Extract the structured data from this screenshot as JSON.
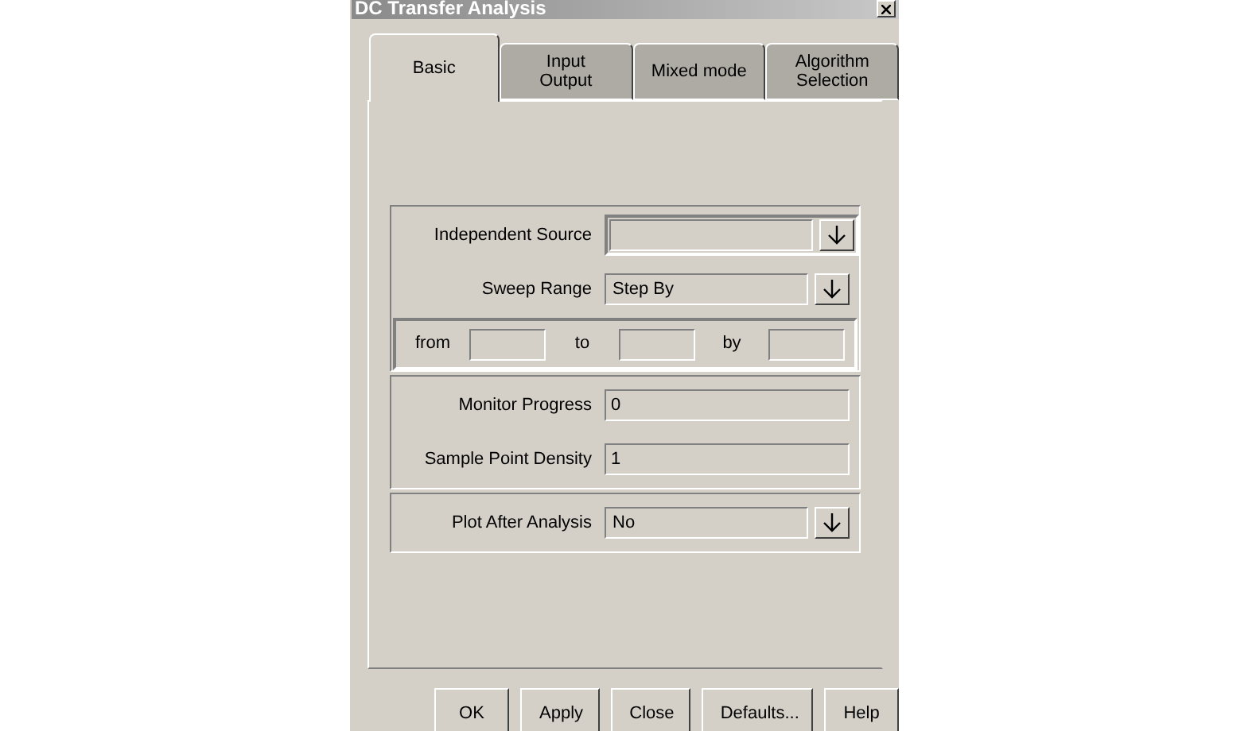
{
  "window": {
    "title": "DC Transfer Analysis"
  },
  "tabs": [
    {
      "label": "Basic",
      "selected": true
    },
    {
      "label": "Input\nOutput",
      "selected": false
    },
    {
      "label": "Mixed mode",
      "selected": false
    },
    {
      "label": "Algorithm\nSelection",
      "selected": false
    }
  ],
  "source_group": {
    "rows": [
      {
        "label": "Independent Source",
        "kind": "dropdown",
        "sunken": true
      },
      {
        "label": "Sweep Range",
        "kind": "dropdown",
        "value": "Step By"
      }
    ],
    "range": [
      {
        "label": "from"
      },
      {
        "label": "to"
      },
      {
        "label": "by"
      }
    ]
  },
  "progress_group": {
    "rows": [
      {
        "label": "Monitor Progress",
        "kind": "field",
        "value": "0"
      },
      {
        "label": "Sample Point Density",
        "kind": "field",
        "value": "1"
      }
    ]
  },
  "plot_group": {
    "rows": [
      {
        "label": "Plot After Analysis",
        "kind": "dropdown",
        "value": "No"
      }
    ]
  },
  "buttons": [
    "OK",
    "Apply",
    "Close",
    "Defaults...",
    "Help"
  ]
}
